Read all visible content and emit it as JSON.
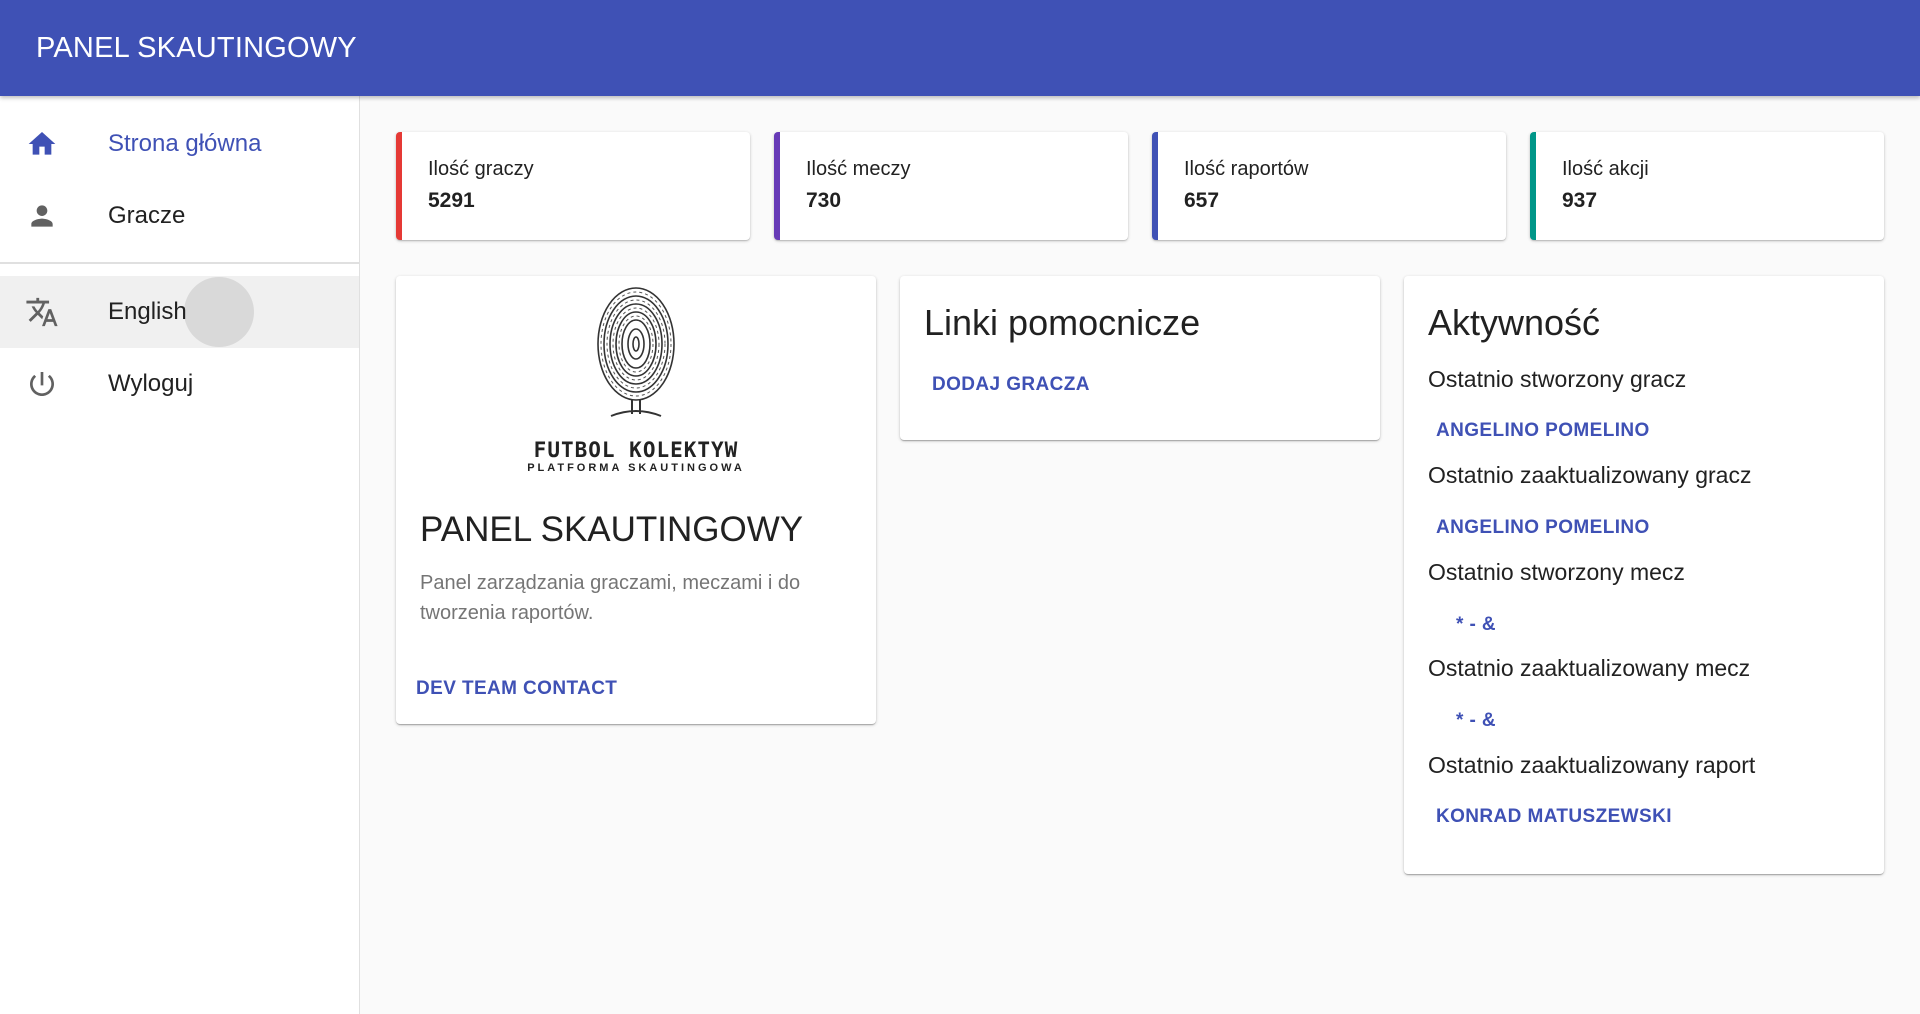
{
  "appbar": {
    "title": "PANEL SKAUTINGOWY"
  },
  "sidebar": {
    "items": [
      {
        "label": "Strona główna",
        "icon": "home-icon"
      },
      {
        "label": "Gracze",
        "icon": "person-icon"
      },
      {
        "label": "English",
        "icon": "translate-icon"
      },
      {
        "label": "Wyloguj",
        "icon": "power-icon"
      }
    ]
  },
  "stats": [
    {
      "label": "Ilość graczy",
      "value": "5291",
      "color": "#e53935"
    },
    {
      "label": "Ilość meczy",
      "value": "730",
      "color": "#673ab7"
    },
    {
      "label": "Ilość raportów",
      "value": "657",
      "color": "#3f51b5"
    },
    {
      "label": "Ilość akcji",
      "value": "937",
      "color": "#009688"
    }
  ],
  "info_card": {
    "logo_text": "FUTBOL KOLEKTYW",
    "logo_subtext": "PLATFORMA SKAUTINGOWA",
    "title": "PANEL SKAUTINGOWY",
    "description": "Panel zarządzania graczami, meczami i do tworzenia raportów.",
    "action": "DEV TEAM CONTACT"
  },
  "links_card": {
    "title": "Linki pomocnicze",
    "links": [
      "DODAJ GRACZA"
    ]
  },
  "activity_card": {
    "title": "Aktywność",
    "rows": [
      {
        "label": "Ostatnio stworzony gracz",
        "link": "ANGELINO POMELINO"
      },
      {
        "label": "Ostatnio zaaktualizowany gracz",
        "link": "ANGELINO POMELINO"
      },
      {
        "label": "Ostatnio stworzony mecz",
        "link": "* - &"
      },
      {
        "label": "Ostatnio zaaktualizowany mecz",
        "link": "* - &"
      },
      {
        "label": "Ostatnio zaaktualizowany raport",
        "link": "KONRAD MATUSZEWSKI"
      }
    ]
  },
  "colors": {
    "primary": "#3f51b5",
    "background": "#fafafa"
  }
}
